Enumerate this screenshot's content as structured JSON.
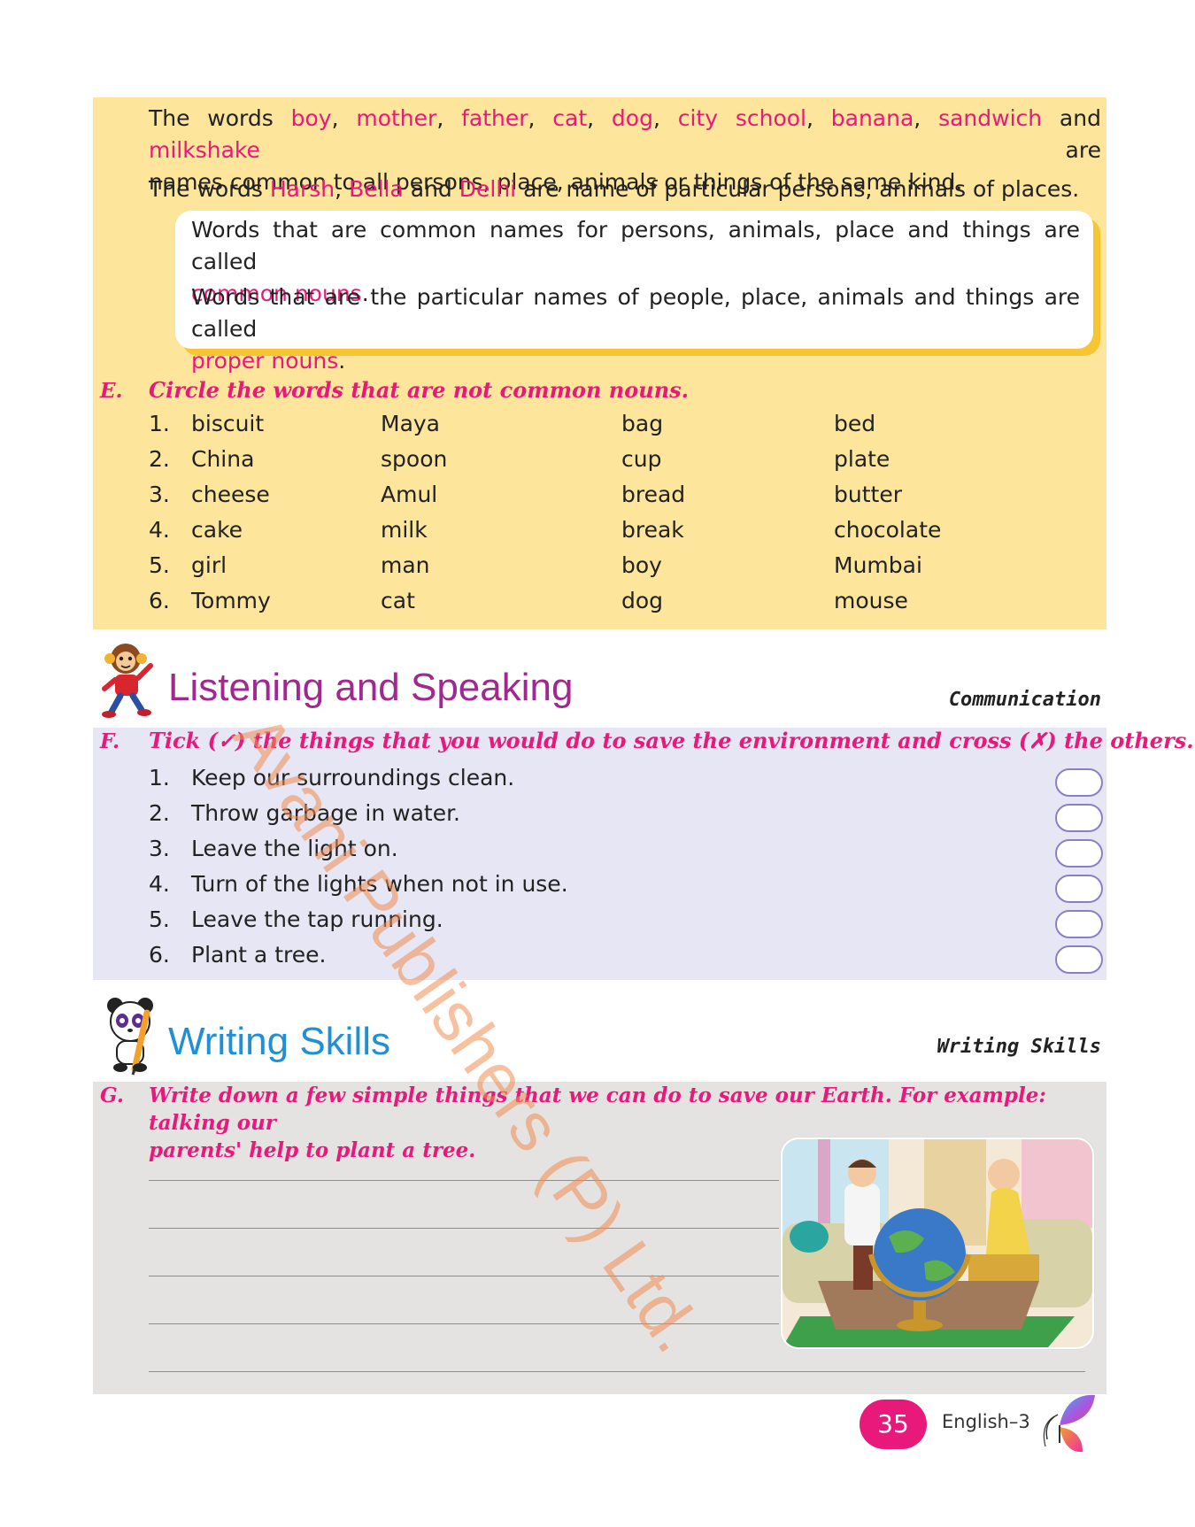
{
  "section_d": {
    "p1_a": "The words ",
    "w_boy": "boy",
    "w_mother": "mother",
    "w_father": "father",
    "w_cat": "cat",
    "w_dog": "dog",
    "w_cityschool": "city school",
    "w_banana": "banana",
    "w_sandwich": "sandwich",
    "p1_and": " and ",
    "w_milkshake": "milkshake",
    "p1_are": " are",
    "p1_b": "names common to all persons, place, animals or things of the same kind.",
    "p2_a": "The words ",
    "w_harsh": "Harsh",
    "w_bella": "Bella",
    "p2_and": " and ",
    "w_delhi": "Delhi",
    "p2_b": " are name of particular persons, animals of places.",
    "def1_a": "Words that are common names for persons, animals, place and things are called",
    "def1_term": "common nouns",
    "def2_a": "Words that are the particular names of people, place, animals and things are called",
    "def2_term": "proper nouns"
  },
  "section_e": {
    "letter": "E.",
    "instruction": "Circle the words that are not common nouns.",
    "rows": [
      {
        "num": "1.",
        "words": [
          "biscuit",
          "Maya",
          "bag",
          "bed"
        ]
      },
      {
        "num": "2.",
        "words": [
          "China",
          "spoon",
          "cup",
          "plate"
        ]
      },
      {
        "num": "3.",
        "words": [
          "cheese",
          "Amul",
          "bread",
          "butter"
        ]
      },
      {
        "num": "4.",
        "words": [
          "cake",
          "milk",
          "break",
          "chocolate"
        ]
      },
      {
        "num": "5.",
        "words": [
          "girl",
          "man",
          "boy",
          "Mumbai"
        ]
      },
      {
        "num": "6.",
        "words": [
          "Tommy",
          "cat",
          "dog",
          "mouse"
        ]
      }
    ]
  },
  "listening": {
    "title": "Listening and Speaking",
    "tag": "Communication"
  },
  "section_f": {
    "letter": "F.",
    "instruction": "Tick (✓) the things that you would do to save the environment and cross (✗) the others.",
    "items": [
      {
        "num": "1.",
        "text": "Keep our surroundings clean."
      },
      {
        "num": "2.",
        "text": "Throw garbage in water."
      },
      {
        "num": "3.",
        "text": "Leave the light on."
      },
      {
        "num": "4.",
        "text": "Turn of the lights when not in use."
      },
      {
        "num": "5.",
        "text": "Leave the tap running."
      },
      {
        "num": "6.",
        "text": "Plant a tree."
      }
    ]
  },
  "writing": {
    "title": "Writing Skills",
    "tag": "Writing Skills"
  },
  "section_g": {
    "letter": "G.",
    "instruction_1": "Write down a few simple things that we can do to save our Earth. For example: talking our",
    "instruction_2": "parents' help to plant a tree."
  },
  "footer": {
    "page_number": "35",
    "book": "English–3"
  },
  "watermark": "Avani Publishers (P) Ltd.",
  "colors": {
    "accent_pink": "#e8197a",
    "yellow_panel": "#fde59c",
    "lilac_panel": "#e6e6f4",
    "gray_panel": "#e5e3e1",
    "listening_title": "#a0288f",
    "writing_title": "#1f90d6"
  }
}
